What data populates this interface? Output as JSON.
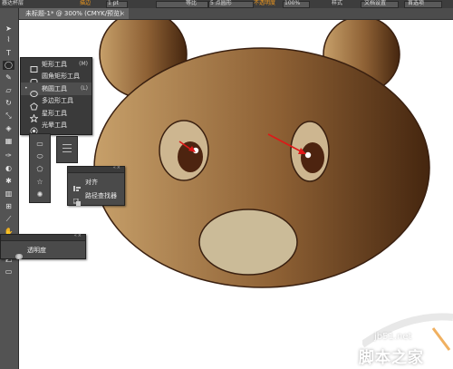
{
  "topbar": {
    "items": [
      "器达杯层",
      "描边",
      "1 pt",
      "等比",
      "5 点圆形",
      "不透明度",
      "100%",
      "样式",
      "文档设置",
      "首选项"
    ],
    "accent": "#f29a1e"
  },
  "document_tab": {
    "title": "未标题-1* @ 300% (CMYK/预览)",
    "close": "×"
  },
  "flyout": {
    "items": [
      {
        "label": "矩形工具",
        "key": "(M)",
        "icon": "rectangle-icon",
        "selected": false
      },
      {
        "label": "圆角矩形工具",
        "key": "",
        "icon": "rounded-rectangle-icon",
        "selected": false
      },
      {
        "label": "椭圆工具",
        "key": "(L)",
        "icon": "ellipse-icon",
        "selected": true
      },
      {
        "label": "多边形工具",
        "key": "",
        "icon": "polygon-icon",
        "selected": false
      },
      {
        "label": "星形工具",
        "key": "",
        "icon": "star-icon",
        "selected": false
      },
      {
        "label": "光晕工具",
        "key": "",
        "icon": "flare-icon",
        "selected": false
      }
    ]
  },
  "align_panel": {
    "items": [
      {
        "label": "对齐",
        "icon": "align-icon"
      },
      {
        "label": "路径查找器",
        "icon": "pathfinder-icon"
      }
    ]
  },
  "transparency_panel": {
    "label": "透明度",
    "icon": "transparency-icon"
  },
  "watermark": {
    "site": "jb51.net",
    "brand": "脚本之家"
  },
  "colors": {
    "bear_left": "#c39a64",
    "bear_right": "#4a2a12",
    "eye_white": "#cdb690",
    "pupil": "#4d2410",
    "muzzle": "#cbbb98",
    "outline": "#3a2010",
    "arrow": "#e01818"
  }
}
